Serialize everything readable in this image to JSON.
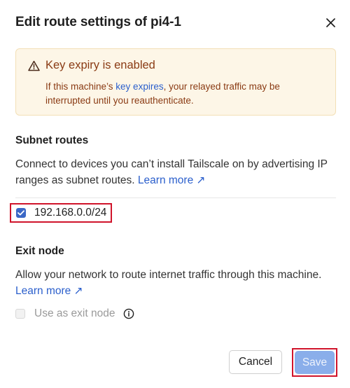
{
  "dialog": {
    "title": "Edit route settings of pi4-1",
    "close_icon": "close-icon"
  },
  "warning": {
    "icon": "warning-triangle-icon",
    "title": "Key expiry is enabled",
    "text_before": "If this machine’s ",
    "link": "key expires",
    "text_after": ", your relayed traffic may be interrupted until you reauthenticate."
  },
  "subnet": {
    "title": "Subnet routes",
    "description": "Connect to devices you can’t install Tailscale on by advertising IP ranges as subnet routes.",
    "learn_more": "Learn more ↗",
    "routes": [
      {
        "label": "192.168.0.0/24",
        "checked": true
      }
    ]
  },
  "exit_node": {
    "title": "Exit node",
    "description": "Allow your network to route internet traffic through this machine.",
    "learn_more": "Learn more ↗",
    "checkbox_label": "Use as exit node",
    "checked": false,
    "disabled": true,
    "info_icon": "info-icon"
  },
  "actions": {
    "cancel": "Cancel",
    "save": "Save"
  },
  "colors": {
    "accent": "#3b68c6",
    "link": "#2b5fcc",
    "warning_text": "#8a3b14",
    "warning_bg": "#fdf6e7",
    "save_disabled": "#8aaeea",
    "highlight": "#d0142b"
  }
}
